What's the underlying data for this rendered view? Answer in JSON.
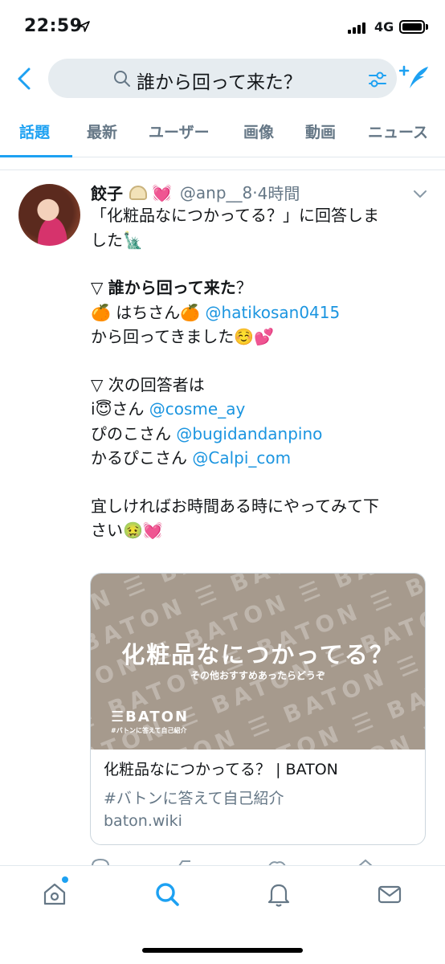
{
  "status": {
    "time": "22:59",
    "network": "4G"
  },
  "search": {
    "query": "誰から回って来た？"
  },
  "tabs": [
    {
      "label": "話題",
      "active": true
    },
    {
      "label": "最新"
    },
    {
      "label": "ユーザー"
    },
    {
      "label": "画像"
    },
    {
      "label": "動画"
    },
    {
      "label": "ニュース"
    }
  ],
  "tweet": {
    "author_name": "餃子",
    "handle": "@anp__8",
    "time": "4時間",
    "lines": {
      "l1": "「化粧品なにつかってる？」に回答しま",
      "l2_text": "した",
      "l3_mark": "▽",
      "l3_bold": "誰から回って来た",
      "l3_q": "？",
      "l4_text": "はちさん",
      "l4_link": "@hatikosan0415",
      "l5_text": "から回ってきました",
      "l6": "▽ 次の回答者は",
      "l7_text": "i",
      "l7_text2": "さん",
      "l7_link": "@cosme_ay",
      "l8_text": "ぴのこさん",
      "l8_link": "@bugidandanpino",
      "l9_text": "かるぴこさん",
      "l9_link": "@Calpi_com",
      "l10": "宜しければお時間ある時にやってみて下",
      "l11_text": "さい"
    },
    "card": {
      "headline": "化粧品なにつかってる？",
      "subline": "その他おすすめあったらどうぞ",
      "logo": "☰BATON",
      "logo_sub": "#バトンに答えて自己紹介",
      "title": "化粧品なにつかってる？ | BATON",
      "description": "#バトンに答えて自己紹介",
      "domain": "baton.wiki"
    }
  },
  "colors": {
    "accent": "#1da1f2",
    "link": "#1b95e0",
    "muted": "#657786"
  },
  "nav": {
    "items": [
      {
        "icon": "home-icon"
      },
      {
        "icon": "search-icon",
        "active": true
      },
      {
        "icon": "bell-icon"
      },
      {
        "icon": "mail-icon"
      }
    ]
  }
}
